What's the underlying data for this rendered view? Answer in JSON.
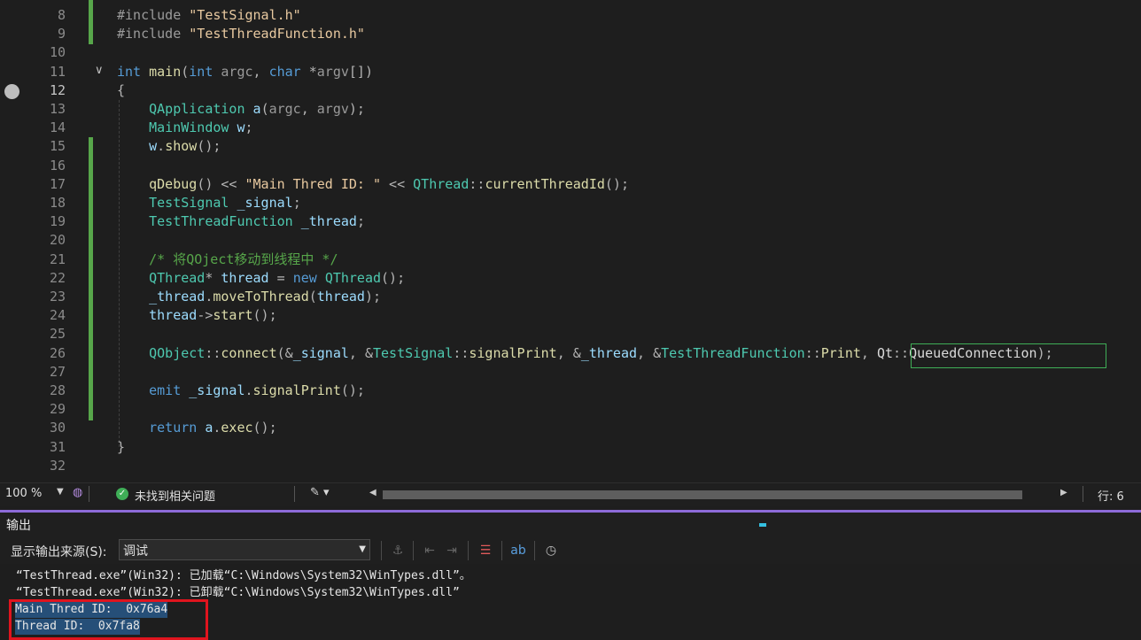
{
  "editor": {
    "lines": [
      {
        "n": "8",
        "tokens": [
          [
            "pp",
            "#include "
          ],
          [
            "st",
            "\"TestSignal.h\""
          ]
        ]
      },
      {
        "n": "9",
        "tokens": [
          [
            "pp",
            "#include "
          ],
          [
            "st",
            "\"TestThreadFunction.h\""
          ]
        ]
      },
      {
        "n": "10",
        "tokens": []
      },
      {
        "n": "11",
        "tokens": [
          [
            "kw",
            "int"
          ],
          [
            "op",
            " "
          ],
          [
            "fn",
            "main"
          ],
          [
            "op",
            "("
          ],
          [
            "kw",
            "int"
          ],
          [
            "op",
            " "
          ],
          [
            "pa",
            "argc"
          ],
          [
            "op",
            ", "
          ],
          [
            "kw",
            "char"
          ],
          [
            "op",
            " *"
          ],
          [
            "pa",
            "argv"
          ],
          [
            "op",
            "[])"
          ]
        ]
      },
      {
        "n": "12",
        "tokens": [
          [
            "op",
            "{"
          ]
        ]
      },
      {
        "n": "13",
        "tokens": [
          [
            "op",
            "    "
          ],
          [
            "ty",
            "QApplication"
          ],
          [
            "op",
            " "
          ],
          [
            "vr",
            "a"
          ],
          [
            "op",
            "("
          ],
          [
            "pa",
            "argc"
          ],
          [
            "op",
            ", "
          ],
          [
            "pa",
            "argv"
          ],
          [
            "op",
            ");"
          ]
        ]
      },
      {
        "n": "14",
        "tokens": [
          [
            "op",
            "    "
          ],
          [
            "ty",
            "MainWindow"
          ],
          [
            "op",
            " "
          ],
          [
            "vr",
            "w"
          ],
          [
            "op",
            ";"
          ]
        ]
      },
      {
        "n": "15",
        "tokens": [
          [
            "op",
            "    "
          ],
          [
            "vr",
            "w"
          ],
          [
            "op",
            "."
          ],
          [
            "fn",
            "show"
          ],
          [
            "op",
            "();"
          ]
        ]
      },
      {
        "n": "16",
        "tokens": []
      },
      {
        "n": "17",
        "tokens": [
          [
            "op",
            "    "
          ],
          [
            "fn",
            "qDebug"
          ],
          [
            "op",
            "() << "
          ],
          [
            "st",
            "\"Main Thred ID: \""
          ],
          [
            "op",
            " << "
          ],
          [
            "ty",
            "QThread"
          ],
          [
            "op",
            "::"
          ],
          [
            "fn",
            "currentThreadId"
          ],
          [
            "op",
            "();"
          ]
        ]
      },
      {
        "n": "18",
        "tokens": [
          [
            "op",
            "    "
          ],
          [
            "ty",
            "TestSignal"
          ],
          [
            "op",
            " "
          ],
          [
            "vr",
            "_signal"
          ],
          [
            "op",
            ";"
          ]
        ]
      },
      {
        "n": "19",
        "tokens": [
          [
            "op",
            "    "
          ],
          [
            "ty",
            "TestThreadFunction"
          ],
          [
            "op",
            " "
          ],
          [
            "vr",
            "_thread"
          ],
          [
            "op",
            ";"
          ]
        ]
      },
      {
        "n": "20",
        "tokens": []
      },
      {
        "n": "21",
        "tokens": [
          [
            "op",
            "    "
          ],
          [
            "cm",
            "/* 将QOject移动到线程中 */"
          ]
        ]
      },
      {
        "n": "22",
        "tokens": [
          [
            "op",
            "    "
          ],
          [
            "ty",
            "QThread"
          ],
          [
            "op",
            "* "
          ],
          [
            "vr",
            "thread"
          ],
          [
            "op",
            " = "
          ],
          [
            "kw",
            "new"
          ],
          [
            "op",
            " "
          ],
          [
            "ty",
            "QThread"
          ],
          [
            "op",
            "();"
          ]
        ]
      },
      {
        "n": "23",
        "tokens": [
          [
            "op",
            "    "
          ],
          [
            "vr",
            "_thread"
          ],
          [
            "op",
            "."
          ],
          [
            "fn",
            "moveToThread"
          ],
          [
            "op",
            "("
          ],
          [
            "vr",
            "thread"
          ],
          [
            "op",
            ");"
          ]
        ]
      },
      {
        "n": "24",
        "tokens": [
          [
            "op",
            "    "
          ],
          [
            "vr",
            "thread"
          ],
          [
            "op",
            "->"
          ],
          [
            "fn",
            "start"
          ],
          [
            "op",
            "();"
          ]
        ]
      },
      {
        "n": "25",
        "tokens": []
      },
      {
        "n": "26",
        "tokens": [
          [
            "op",
            "    "
          ],
          [
            "ty",
            "QObject"
          ],
          [
            "op",
            "::"
          ],
          [
            "fn",
            "connect"
          ],
          [
            "op",
            "(&"
          ],
          [
            "vr",
            "_signal"
          ],
          [
            "op",
            ", &"
          ],
          [
            "ty",
            "TestSignal"
          ],
          [
            "op",
            "::"
          ],
          [
            "fn",
            "signalPrint"
          ],
          [
            "op",
            ", &"
          ],
          [
            "vr",
            "_thread"
          ],
          [
            "op",
            ", &"
          ],
          [
            "ty",
            "TestThreadFunction"
          ],
          [
            "op",
            "::"
          ],
          [
            "fn",
            "Print"
          ],
          [
            "op",
            ", "
          ],
          [
            "mb",
            "Qt"
          ],
          [
            "op",
            "::"
          ],
          [
            "mb",
            "QueuedConnection"
          ],
          [
            "op",
            ");"
          ]
        ]
      },
      {
        "n": "27",
        "tokens": []
      },
      {
        "n": "28",
        "tokens": [
          [
            "op",
            "    "
          ],
          [
            "kw",
            "emit"
          ],
          [
            "op",
            " "
          ],
          [
            "vr",
            "_signal"
          ],
          [
            "op",
            "."
          ],
          [
            "fn",
            "signalPrint"
          ],
          [
            "op",
            "();"
          ]
        ]
      },
      {
        "n": "29",
        "tokens": []
      },
      {
        "n": "30",
        "tokens": [
          [
            "op",
            "    "
          ],
          [
            "kw",
            "return"
          ],
          [
            "op",
            " "
          ],
          [
            "vr",
            "a"
          ],
          [
            "op",
            "."
          ],
          [
            "fn",
            "exec"
          ],
          [
            "op",
            "();"
          ]
        ]
      },
      {
        "n": "31",
        "tokens": [
          [
            "op",
            "}"
          ]
        ]
      },
      {
        "n": "32",
        "tokens": []
      }
    ],
    "current_line": "12"
  },
  "statusbar": {
    "zoom": "100 %",
    "issues_text": "未找到相关问题",
    "row_label": "行: 6"
  },
  "output": {
    "panel_title": "输出",
    "source_label": "显示输出来源(S):",
    "source_value": "调试",
    "lines": [
      "“TestThread.exe”(Win32): 已加载“C:\\Windows\\System32\\WinTypes.dll”。",
      "“TestThread.exe”(Win32): 已卸载“C:\\Windows\\System32\\WinTypes.dll”",
      "Main Thred ID:  0x76a4",
      "Thread ID:  0x7fa8"
    ]
  },
  "colors": {
    "accent": "#8d6bd8",
    "highlight_box": "#3fae57",
    "annotation_box": "#e0141e"
  }
}
